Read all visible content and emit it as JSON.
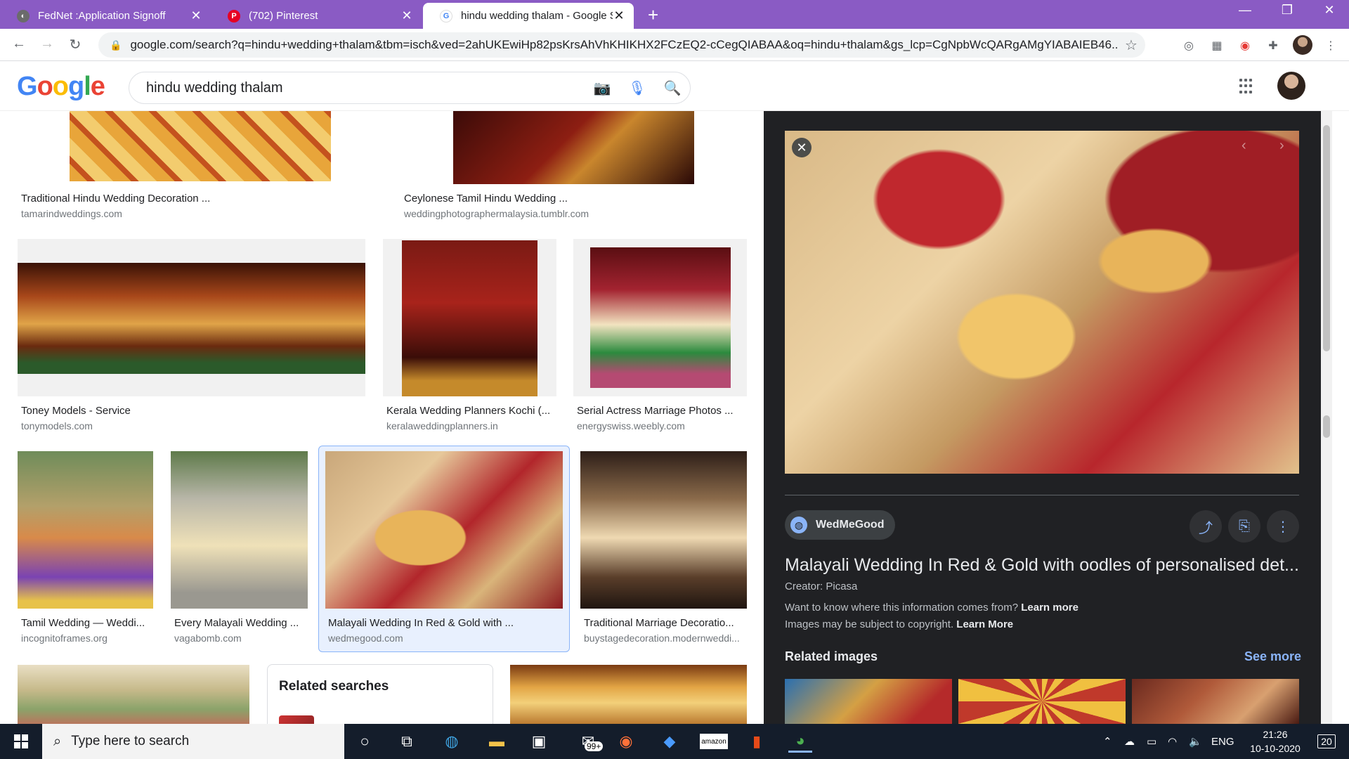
{
  "browser": {
    "tabs": [
      {
        "title": "FedNet :Application Signoff",
        "favicon": "globe-icon",
        "favicon_color": "#5f6368"
      },
      {
        "title": "(702) Pinterest",
        "favicon": "pinterest-icon",
        "favicon_color": "#e60023"
      },
      {
        "title": "hindu wedding thalam - Google S",
        "favicon": "google-icon",
        "favicon_color": "#4285f4"
      }
    ],
    "url": "google.com/search?q=hindu+wedding+thalam&tbm=isch&ved=2ahUKEwiHp82psKrsAhVhKHIKHX2FCzEQ2-cCegQIABAA&oq=hindu+thalam&gs_lcp=CgNpbWcQARgAMgYIABAIEB46...",
    "accent": "#8a5bc4"
  },
  "google": {
    "logo": "Google",
    "query": "hindu wedding thalam"
  },
  "results": [
    {
      "title": "Traditional Hindu Wedding Decoration ...",
      "source": "tamarindweddings.com"
    },
    {
      "title": "Ceylonese Tamil Hindu Wedding ...",
      "source": "weddingphotographermalaysia.tumblr.com"
    },
    {
      "title": "Toney Models - Service",
      "source": "tonymodels.com"
    },
    {
      "title": "Kerala Wedding Planners Kochi (...",
      "source": "keralaweddingplanners.in"
    },
    {
      "title": "Serial Actress Marriage Photos ...",
      "source": "energyswiss.weebly.com"
    },
    {
      "title": "Tamil Wedding — Weddi...",
      "source": "incognitoframes.org"
    },
    {
      "title": "Every Malayali Wedding ...",
      "source": "vagabomb.com"
    },
    {
      "title": "Malayali Wedding In Red & Gold with ...",
      "source": "wedmegood.com"
    },
    {
      "title": "Traditional Marriage Decoratio...",
      "source": "buystagedecoration.modernweddi..."
    }
  ],
  "related_searches": {
    "title": "Related searches"
  },
  "panel": {
    "source": "WedMeGood",
    "title": "Malayali Wedding In Red & Gold with oodles of personalised det...",
    "creator": "Creator: Picasa",
    "info1_text": "Want to know where this information comes from?",
    "info1_link": "Learn more",
    "info2_text": "Images may be subject to copyright.",
    "info2_link": "Learn More",
    "related_title": "Related images",
    "see_more": "See more"
  },
  "taskbar": {
    "search_placeholder": "Type here to search",
    "mail_badge": "99+",
    "amazon_label": "amazon",
    "lang": "ENG",
    "time": "21:26",
    "date": "10-10-2020",
    "notifications": "20"
  }
}
